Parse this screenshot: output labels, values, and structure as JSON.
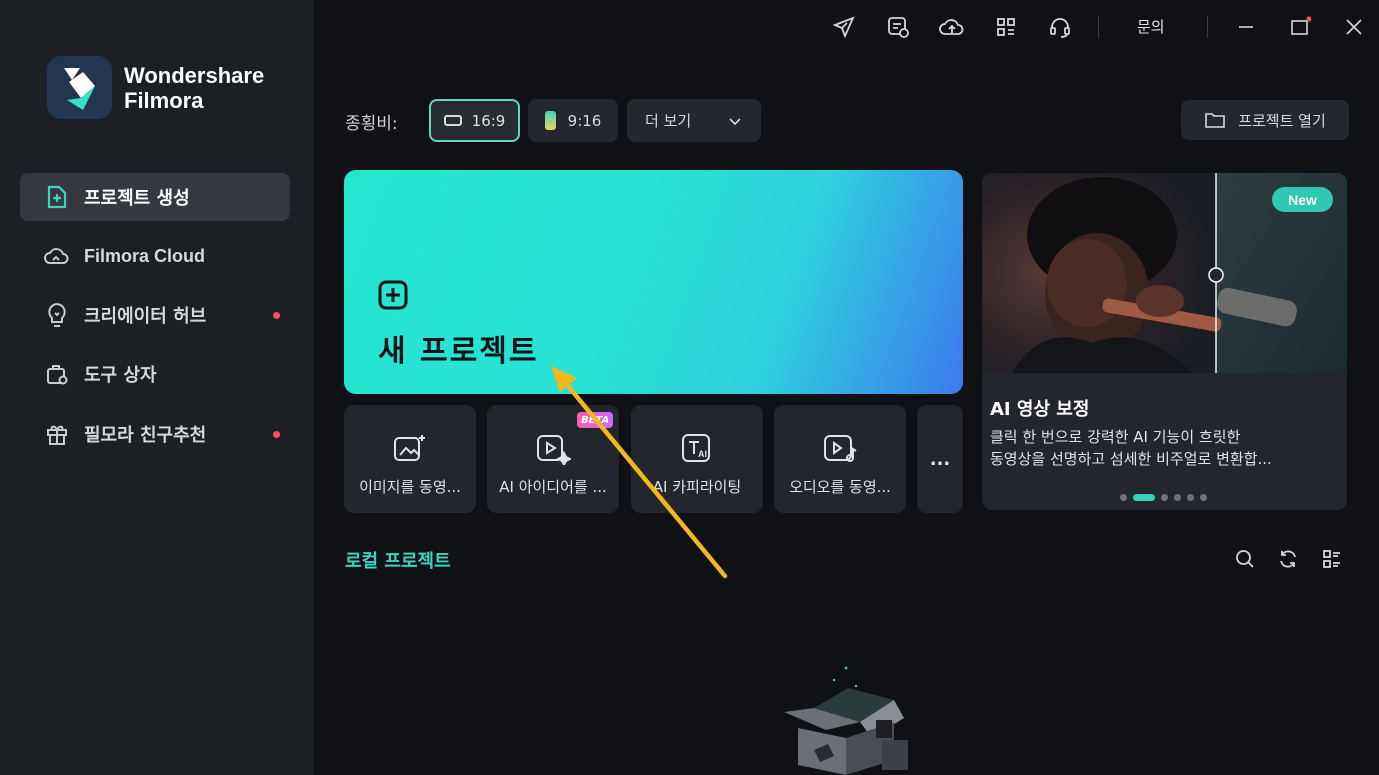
{
  "sidebar": {
    "logo_line1": "Wondershare",
    "logo_line2": "Filmora",
    "items": [
      {
        "label": "프로젝트 생성",
        "icon": "new-project-icon",
        "active": true
      },
      {
        "label": "Filmora Cloud",
        "icon": "cloud-icon"
      },
      {
        "label": "크리에이터 허브",
        "icon": "lightbulb-icon",
        "badge": true
      },
      {
        "label": "도구 상자",
        "icon": "toolbox-icon"
      },
      {
        "label": "필모라 친구추천",
        "icon": "gift-icon",
        "badge": true
      }
    ]
  },
  "topbar": {
    "icons": [
      "send-icon",
      "feedback-icon",
      "cloud-upload-icon",
      "grid-icon",
      "headset-icon"
    ],
    "inquiry_label": "문의"
  },
  "aspect": {
    "label": "종횡비:",
    "options": [
      "16:9",
      "9:16"
    ],
    "selected": "16:9",
    "more_label": "더 보기"
  },
  "open_project_label": "프로젝트 열기",
  "new_project_label": "새 프로젝트",
  "tools": [
    {
      "label": "이미지를 동영...",
      "icon": "image-to-video-icon"
    },
    {
      "label": "AI 아이디어를 ...",
      "icon": "ai-idea-icon",
      "badge": "BETA"
    },
    {
      "label": "AI 카피라이팅",
      "icon": "ai-copywriting-icon"
    },
    {
      "label": "오디오를 동영...",
      "icon": "audio-to-video-icon"
    }
  ],
  "more_label": "...",
  "promo": {
    "badge": "New",
    "title": "AI 영상 보정",
    "desc_line1": "클릭 한 번으로 강력한 AI 기능이 흐릿한",
    "desc_line2": "동영상을 선명하고 섬세한 비주얼로 변환합...",
    "slides": 6,
    "active_slide": 1
  },
  "local": {
    "title": "로컬 프로젝트",
    "icons": [
      "search-icon",
      "refresh-icon",
      "list-view-icon"
    ]
  },
  "colors": {
    "accent": "#3fd2bd",
    "sidebar_bg": "#1c1f24",
    "main_bg": "#0f1115",
    "badge_red": "#ff4d5a",
    "annotation_arrow": "#f5b81a"
  }
}
